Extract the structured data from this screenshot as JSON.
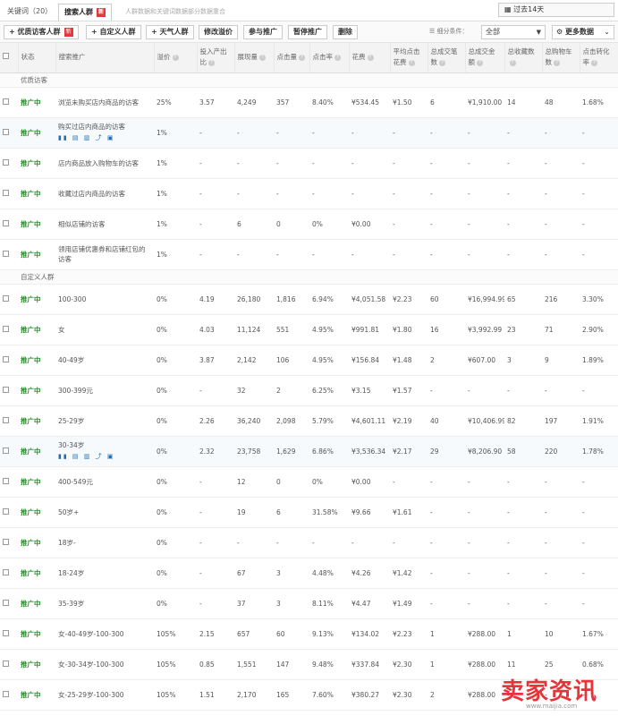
{
  "tabs": {
    "keywords": "关键词（20）",
    "search_crowd": "搜索人群",
    "search_crowd_badge": "新",
    "hint": "人群数据和关键词数据部分数据重合"
  },
  "period": {
    "label": "过去14天"
  },
  "toolbar": {
    "add_quality": "优质访客人群",
    "add_quality_badge": "新",
    "add_custom": "自定义人群",
    "add_weather": "天气人群",
    "edit_premium": "修改溢价",
    "join_promo": "参与推广",
    "pause_promo": "暂停推广",
    "delete": "删除",
    "filter_label": "细分条件：",
    "filter_value": "全部",
    "more_data": "更多数据"
  },
  "columns": [
    "状态",
    "搜索推广",
    "溢价",
    "投入产出比",
    "展现量",
    "点击量",
    "点击率",
    "花费",
    "平均点击花费",
    "总成交笔数",
    "总成交金额",
    "总收藏数",
    "总购物车数",
    "点击转化率"
  ],
  "sections": {
    "quality": "优质访客",
    "custom": "自定义人群"
  },
  "quality_rows": [
    {
      "status": "推广中",
      "name": "浏览未购买店内商品的访客",
      "premium": "25%",
      "roi": "3.57",
      "impr": "4,249",
      "clicks": "357",
      "ctr": "8.40%",
      "cost": "¥534.45",
      "cpc": "¥1.50",
      "orders": "6",
      "amount": "¥1,910.00",
      "fav": "14",
      "cart": "48",
      "cvr": "1.68%",
      "ops": false,
      "hi": false
    },
    {
      "status": "推广中",
      "name": "购买过店内商品的访客",
      "premium": "1%",
      "roi": "-",
      "impr": "-",
      "clicks": "-",
      "ctr": "-",
      "cost": "-",
      "cpc": "-",
      "orders": "-",
      "amount": "-",
      "fav": "-",
      "cart": "-",
      "cvr": "-",
      "ops": true,
      "hi": true
    },
    {
      "status": "推广中",
      "name": "店内商品放入购物车的访客",
      "premium": "1%",
      "roi": "-",
      "impr": "-",
      "clicks": "-",
      "ctr": "-",
      "cost": "-",
      "cpc": "-",
      "orders": "-",
      "amount": "-",
      "fav": "-",
      "cart": "-",
      "cvr": "-",
      "ops": false,
      "hi": false
    },
    {
      "status": "推广中",
      "name": "收藏过店内商品的访客",
      "premium": "1%",
      "roi": "-",
      "impr": "-",
      "clicks": "-",
      "ctr": "-",
      "cost": "-",
      "cpc": "-",
      "orders": "-",
      "amount": "-",
      "fav": "-",
      "cart": "-",
      "cvr": "-",
      "ops": false,
      "hi": false
    },
    {
      "status": "推广中",
      "name": "相似店铺的访客",
      "premium": "1%",
      "roi": "-",
      "impr": "6",
      "clicks": "0",
      "ctr": "0%",
      "cost": "¥0.00",
      "cpc": "-",
      "orders": "-",
      "amount": "-",
      "fav": "-",
      "cart": "-",
      "cvr": "-",
      "ops": false,
      "hi": false
    },
    {
      "status": "推广中",
      "name": "领用店铺优惠券和店铺红包的访客",
      "premium": "1%",
      "roi": "-",
      "impr": "-",
      "clicks": "-",
      "ctr": "-",
      "cost": "-",
      "cpc": "-",
      "orders": "-",
      "amount": "-",
      "fav": "-",
      "cart": "-",
      "cvr": "-",
      "ops": false,
      "hi": false
    }
  ],
  "custom_rows": [
    {
      "status": "推广中",
      "name": "100-300",
      "premium": "0%",
      "roi": "4.19",
      "impr": "26,180",
      "clicks": "1,816",
      "ctr": "6.94%",
      "cost": "¥4,051.58",
      "cpc": "¥2.23",
      "orders": "60",
      "amount": "¥16,994.99",
      "fav": "65",
      "cart": "216",
      "cvr": "3.30%",
      "ops": false,
      "hi": false
    },
    {
      "status": "推广中",
      "name": "女",
      "premium": "0%",
      "roi": "4.03",
      "impr": "11,124",
      "clicks": "551",
      "ctr": "4.95%",
      "cost": "¥991.81",
      "cpc": "¥1.80",
      "orders": "16",
      "amount": "¥3,992.99",
      "fav": "23",
      "cart": "71",
      "cvr": "2.90%",
      "ops": false,
      "hi": false
    },
    {
      "status": "推广中",
      "name": "40-49岁",
      "premium": "0%",
      "roi": "3.87",
      "impr": "2,142",
      "clicks": "106",
      "ctr": "4.95%",
      "cost": "¥156.84",
      "cpc": "¥1.48",
      "orders": "2",
      "amount": "¥607.00",
      "fav": "3",
      "cart": "9",
      "cvr": "1.89%",
      "ops": false,
      "hi": false
    },
    {
      "status": "推广中",
      "name": "300-399元",
      "premium": "0%",
      "roi": "-",
      "impr": "32",
      "clicks": "2",
      "ctr": "6.25%",
      "cost": "¥3.15",
      "cpc": "¥1.57",
      "orders": "-",
      "amount": "-",
      "fav": "-",
      "cart": "-",
      "cvr": "-",
      "ops": false,
      "hi": false
    },
    {
      "status": "推广中",
      "name": "25-29岁",
      "premium": "0%",
      "roi": "2.26",
      "impr": "36,240",
      "clicks": "2,098",
      "ctr": "5.79%",
      "cost": "¥4,601.11",
      "cpc": "¥2.19",
      "orders": "40",
      "amount": "¥10,406.99",
      "fav": "82",
      "cart": "197",
      "cvr": "1.91%",
      "ops": false,
      "hi": false
    },
    {
      "status": "推广中",
      "name": "30-34岁",
      "premium": "0%",
      "roi": "2.32",
      "impr": "23,758",
      "clicks": "1,629",
      "ctr": "6.86%",
      "cost": "¥3,536.34",
      "cpc": "¥2.17",
      "orders": "29",
      "amount": "¥8,206.90",
      "fav": "58",
      "cart": "220",
      "cvr": "1.78%",
      "ops": true,
      "hi": true
    },
    {
      "status": "推广中",
      "name": "400-549元",
      "premium": "0%",
      "roi": "-",
      "impr": "12",
      "clicks": "0",
      "ctr": "0%",
      "cost": "¥0.00",
      "cpc": "-",
      "orders": "-",
      "amount": "-",
      "fav": "-",
      "cart": "-",
      "cvr": "-",
      "ops": false,
      "hi": false
    },
    {
      "status": "推广中",
      "name": "50岁+",
      "premium": "0%",
      "roi": "-",
      "impr": "19",
      "clicks": "6",
      "ctr": "31.58%",
      "cost": "¥9.66",
      "cpc": "¥1.61",
      "orders": "-",
      "amount": "-",
      "fav": "-",
      "cart": "-",
      "cvr": "-",
      "ops": false,
      "hi": false
    },
    {
      "status": "推广中",
      "name": "18岁-",
      "premium": "0%",
      "roi": "-",
      "impr": "-",
      "clicks": "-",
      "ctr": "-",
      "cost": "-",
      "cpc": "-",
      "orders": "-",
      "amount": "-",
      "fav": "-",
      "cart": "-",
      "cvr": "-",
      "ops": false,
      "hi": false
    },
    {
      "status": "推广中",
      "name": "18-24岁",
      "premium": "0%",
      "roi": "-",
      "impr": "67",
      "clicks": "3",
      "ctr": "4.48%",
      "cost": "¥4.26",
      "cpc": "¥1.42",
      "orders": "-",
      "amount": "-",
      "fav": "-",
      "cart": "-",
      "cvr": "-",
      "ops": false,
      "hi": false
    },
    {
      "status": "推广中",
      "name": "35-39岁",
      "premium": "0%",
      "roi": "-",
      "impr": "37",
      "clicks": "3",
      "ctr": "8.11%",
      "cost": "¥4.47",
      "cpc": "¥1.49",
      "orders": "-",
      "amount": "-",
      "fav": "-",
      "cart": "-",
      "cvr": "-",
      "ops": false,
      "hi": false
    },
    {
      "status": "推广中",
      "name": "女-40-49岁-100-300",
      "premium": "105%",
      "roi": "2.15",
      "impr": "657",
      "clicks": "60",
      "ctr": "9.13%",
      "cost": "¥134.02",
      "cpc": "¥2.23",
      "orders": "1",
      "amount": "¥288.00",
      "fav": "1",
      "cart": "10",
      "cvr": "1.67%",
      "ops": false,
      "hi": false
    },
    {
      "status": "推广中",
      "name": "女-30-34岁-100-300",
      "premium": "105%",
      "roi": "0.85",
      "impr": "1,551",
      "clicks": "147",
      "ctr": "9.48%",
      "cost": "¥337.84",
      "cpc": "¥2.30",
      "orders": "1",
      "amount": "¥288.00",
      "fav": "11",
      "cart": "25",
      "cvr": "0.68%",
      "ops": false,
      "hi": false
    },
    {
      "status": "推广中",
      "name": "女-25-29岁-100-300",
      "premium": "105%",
      "roi": "1.51",
      "impr": "2,170",
      "clicks": "165",
      "ctr": "7.60%",
      "cost": "¥380.27",
      "cpc": "¥2.30",
      "orders": "2",
      "amount": "¥288.00",
      "fav": "-",
      "cart": "-",
      "cvr": "-",
      "ops": false,
      "hi": false
    }
  ],
  "ops_icons": "▮▮ ▤ ▥ ⤴ ▣",
  "watermark": {
    "big": "卖家资讯",
    "small": "www.maijia.com"
  }
}
